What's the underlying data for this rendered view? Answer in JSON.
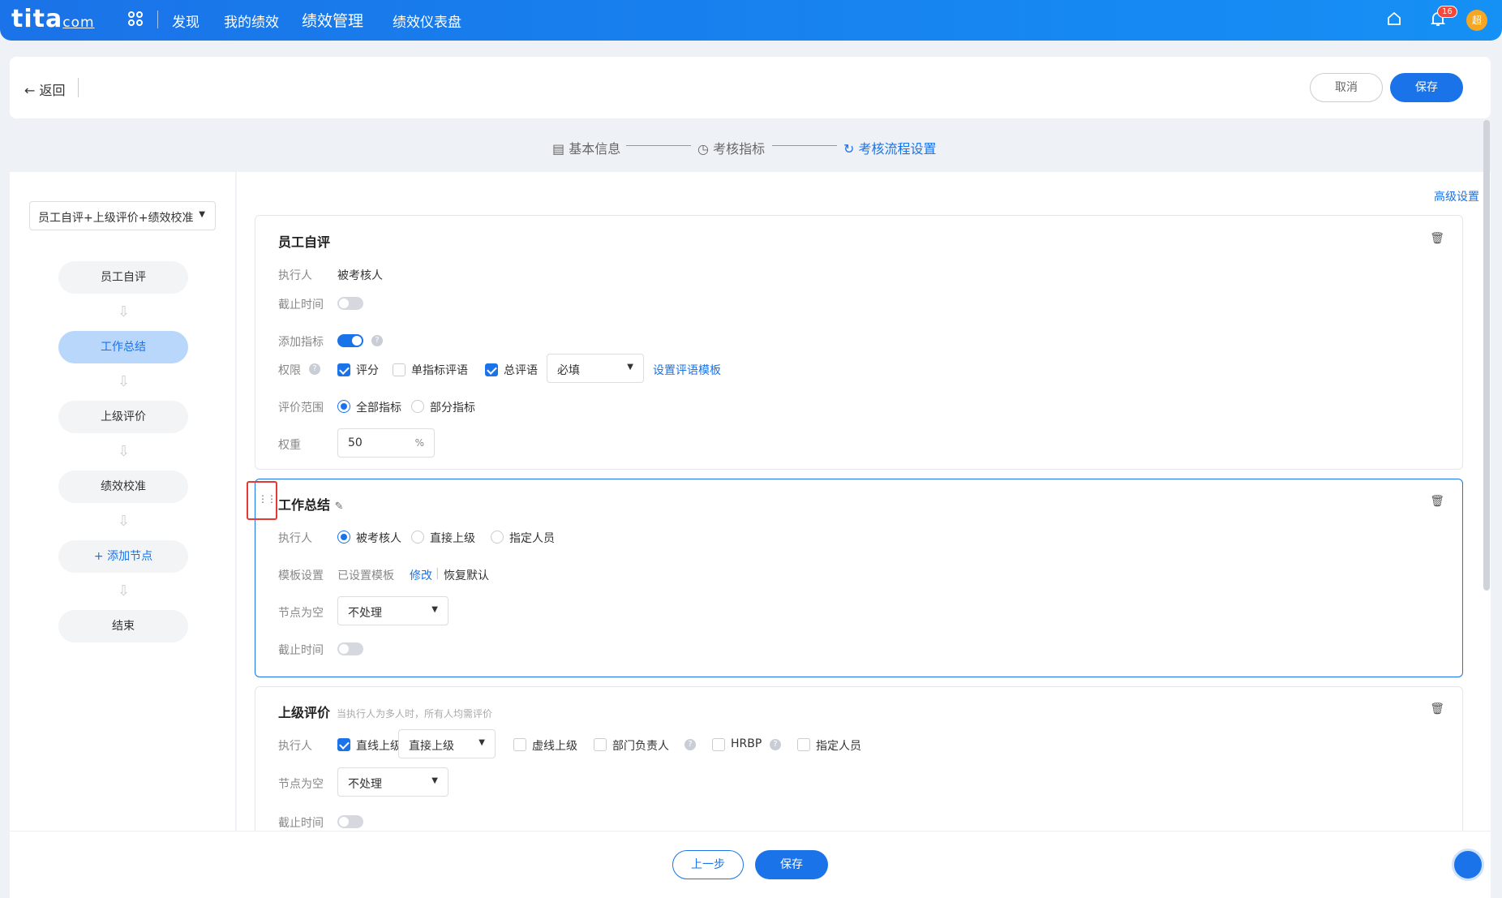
{
  "topnav": {
    "logo": "tita",
    "logo_suffix": "com",
    "items": [
      "发现",
      "我的绩效",
      "绩效管理",
      "绩效仪表盘"
    ],
    "badge_count": "16",
    "avatar_text": "超"
  },
  "header": {
    "back_label": "返回",
    "cancel_label": "取消",
    "save_label": "保存"
  },
  "steps": [
    "基本信息",
    "考核指标",
    "考核流程设置"
  ],
  "left": {
    "flow_select": "员工自评+上级评价+绩效校准",
    "nodes": [
      "员工自评",
      "工作总结",
      "上级评价",
      "绩效校准",
      "添加节点",
      "结束"
    ]
  },
  "main": {
    "advanced_link": "高级设置",
    "card1": {
      "title": "员工自评",
      "executor_label": "执行人",
      "executor_value": "被考核人",
      "deadline_label": "截止时间",
      "add_metric_label": "添加指标",
      "perm_label": "权限",
      "perm_score": "评分",
      "perm_single": "单指标评语",
      "perm_total": "总评语",
      "required_select": "必填",
      "template_link": "设置评语模板",
      "range_label": "评价范围",
      "range_all": "全部指标",
      "range_part": "部分指标",
      "weight_label": "权重",
      "weight_value": "50",
      "weight_unit": "%"
    },
    "card2": {
      "title": "工作总结",
      "executor_label": "执行人",
      "opt_reviewee": "被考核人",
      "opt_direct": "直接上级",
      "opt_assigned": "指定人员",
      "template_label": "模板设置",
      "template_status": "已设置模板",
      "modify_link": "修改",
      "restore_link": "恢复默认",
      "empty_label": "节点为空",
      "empty_select": "不处理",
      "deadline_label": "截止时间"
    },
    "card3": {
      "title": "上级评价",
      "hint": "当执行人为多人时，所有人均需评价",
      "executor_label": "执行人",
      "opt_line": "直线上级",
      "line_select": "直接上级",
      "opt_dotted": "虚线上级",
      "opt_dept": "部门负责人",
      "opt_hrbp": "HRBP",
      "opt_assigned": "指定人员",
      "empty_label": "节点为空",
      "empty_select": "不处理",
      "deadline_label": "截止时间"
    }
  },
  "footer": {
    "prev_label": "上一步",
    "save_label": "保存"
  },
  "colors": {
    "primary": "#1a73e8",
    "active_node": "#b9d6fb",
    "highlight": "#e53935"
  }
}
